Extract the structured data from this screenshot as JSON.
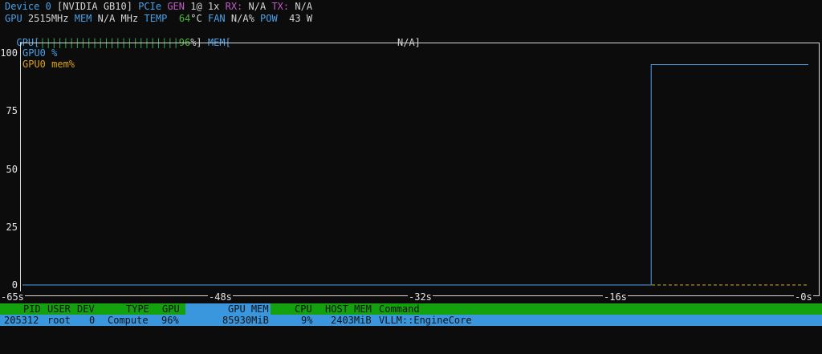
{
  "header": {
    "line1": {
      "device_label": "Device 0",
      "device_name": "[NVIDIA GB10]",
      "pcie_label": "PCIe",
      "gen_label": "GEN",
      "gen_value": "1@ 1x",
      "rx_label": "RX:",
      "rx_value": "N/A",
      "tx_label": "TX:",
      "tx_value": "N/A"
    },
    "line2": {
      "gpu_label": "GPU",
      "gpu_clock": "2515MHz",
      "mem_label": "MEM",
      "mem_clock": "N/A MHz",
      "temp_label": "TEMP",
      "temp_value": "64",
      "temp_unit": "°C",
      "fan_label": "FAN",
      "fan_value": "N/A%",
      "pow_label": "POW",
      "pow_value": "43 W"
    },
    "line3": {
      "gpu_bar_label": "GPU[",
      "gpu_bar_fill": "||||||||||||||||||||||||",
      "gpu_bar_value": "96",
      "gpu_bar_end": "%]",
      "gpu_util_fraction": 0.96,
      "mem_bar_label": "MEM[",
      "mem_bar_value": "N/A]"
    }
  },
  "chart_data": {
    "type": "line",
    "x": [
      -65,
      -48,
      -32,
      -16,
      0
    ],
    "xtick_labels": [
      "65s",
      "48s",
      "32s",
      "16s",
      "0s"
    ],
    "ytick_labels": [
      "100",
      "75",
      "50",
      "25",
      "0"
    ],
    "ylim": [
      0,
      100
    ],
    "xlim": [
      -65,
      0
    ],
    "series": [
      {
        "name": "GPU0 %",
        "color": "#4aa0e6",
        "points": [
          [
            -65,
            0
          ],
          [
            -13,
            0
          ],
          [
            -13,
            95
          ],
          [
            0,
            95
          ]
        ]
      },
      {
        "name": "GPU0 mem%",
        "color": "#d7a21e",
        "points": [
          [
            -65,
            0
          ],
          [
            0,
            0
          ]
        ]
      }
    ],
    "legend_placement": "top-left",
    "grid": false
  },
  "process_table": {
    "headers": {
      "pid": "PID",
      "user": "USER",
      "dev": "DEV",
      "type": "TYPE",
      "gpu": "GPU",
      "gpu_mem": "GPU MEM",
      "cpu": "CPU",
      "host_mem": "HOST MEM",
      "command": "Command"
    },
    "rows": [
      {
        "pid": "205312",
        "user": "root",
        "dev": "0",
        "type": "Compute",
        "gpu": "96%",
        "gpu_mem": "85930MiB",
        "cpu": "9%",
        "host_mem": "2403MiB",
        "command": "VLLM::EngineCore"
      }
    ]
  },
  "colors": {
    "background": "#0c0c0c",
    "label_blue": "#4aa0e6",
    "label_magenta": "#c05ac8",
    "value_green": "#4bb43c",
    "header_green": "#13a10e",
    "row_blue": "#3a96dd"
  }
}
